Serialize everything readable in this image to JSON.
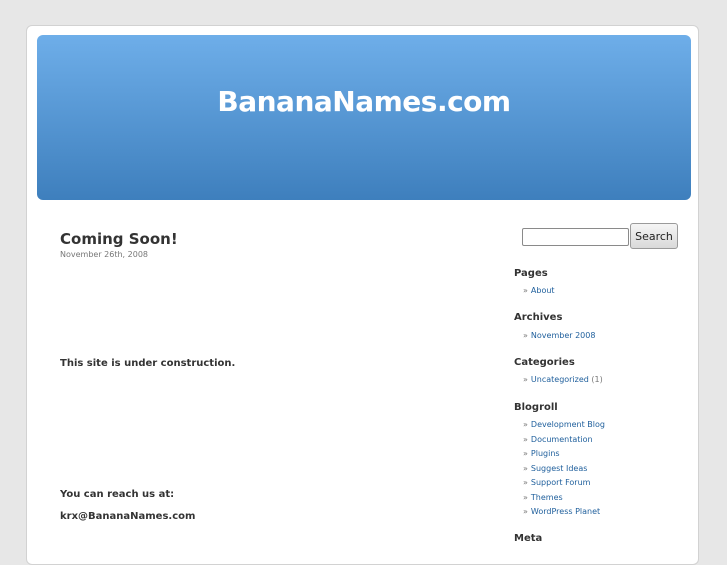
{
  "header": {
    "blog_title": "BananaNames.com"
  },
  "post": {
    "title": "Coming Soon!",
    "date": "November 26th, 2008",
    "construction": "This site is under construction.",
    "reach_us": "You can reach us at:",
    "email": "krx@BananaNames.com"
  },
  "search": {
    "value": "",
    "button_label": "Search"
  },
  "sidebar": {
    "bullet": "»",
    "pages": {
      "heading": "Pages",
      "items": [
        {
          "label": "About"
        }
      ]
    },
    "archives": {
      "heading": "Archives",
      "items": [
        {
          "label": "November 2008"
        }
      ]
    },
    "categories": {
      "heading": "Categories",
      "items": [
        {
          "label": "Uncategorized",
          "count": "(1)"
        }
      ]
    },
    "blogroll": {
      "heading": "Blogroll",
      "items": [
        {
          "label": "Development Blog"
        },
        {
          "label": "Documentation"
        },
        {
          "label": "Plugins"
        },
        {
          "label": "Suggest Ideas"
        },
        {
          "label": "Support Forum"
        },
        {
          "label": "Themes"
        },
        {
          "label": "WordPress Planet"
        }
      ]
    },
    "meta": {
      "heading": "Meta"
    }
  },
  "colors": {
    "header_top": "#6eaee9",
    "header_bottom": "#3e7fbd",
    "link": "#1f5f9c",
    "background": "#e7e7e7"
  }
}
